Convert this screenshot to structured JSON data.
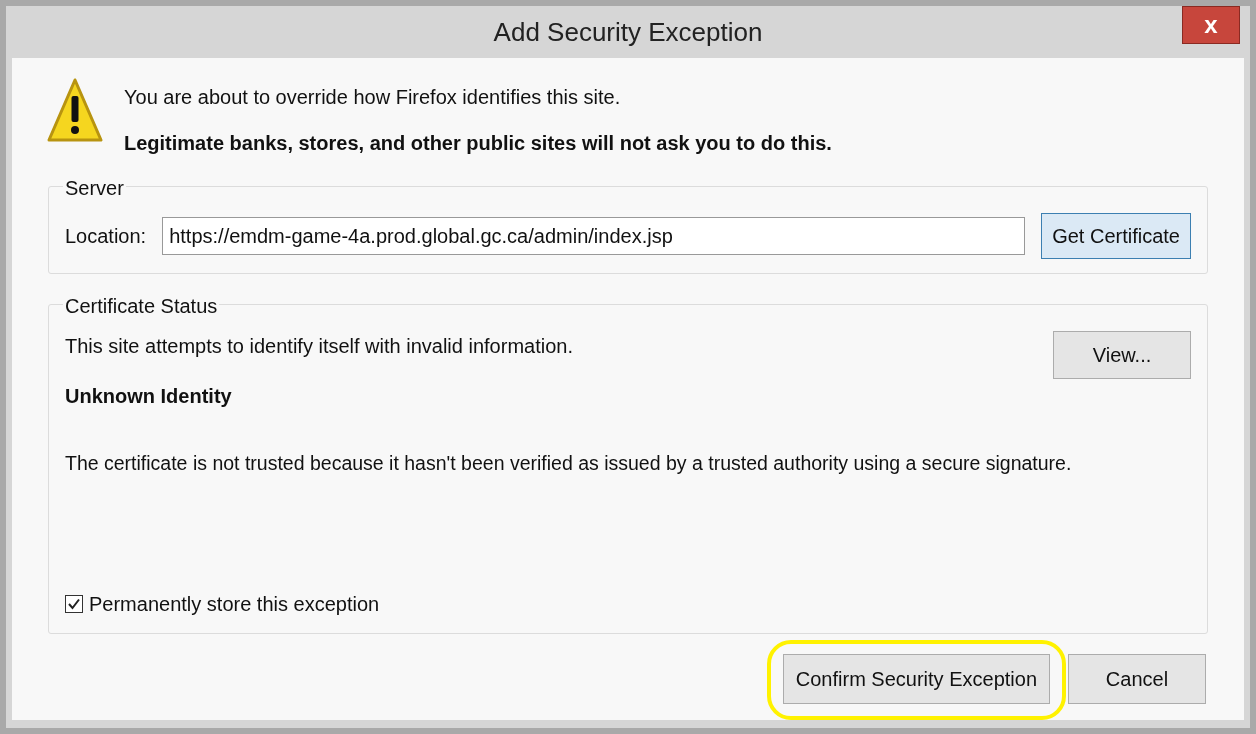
{
  "window": {
    "title": "Add Security Exception",
    "close": "x"
  },
  "warning": {
    "line1": "You are about to override how Firefox identifies this site.",
    "line2": "Legitimate banks, stores, and other public sites will not ask you to do this."
  },
  "server": {
    "legend": "Server",
    "location_label": "Location:",
    "location_value": "https://emdm-game-4a.prod.global.gc.ca/admin/index.jsp",
    "get_button": "Get Certificate"
  },
  "status": {
    "legend": "Certificate Status",
    "summary": "This site attempts to identify itself with invalid information.",
    "view_button": "View...",
    "heading": "Unknown Identity",
    "detail": "The certificate is not trusted because it hasn't been verified as issued by a trusted authority using a secure signature.",
    "permanent": {
      "label": "Permanently store this exception",
      "checked": true
    }
  },
  "buttons": [
    {
      "label": "Confirm Security Exception",
      "highlighted": true
    },
    {
      "label": "Cancel",
      "highlighted": false
    }
  ]
}
